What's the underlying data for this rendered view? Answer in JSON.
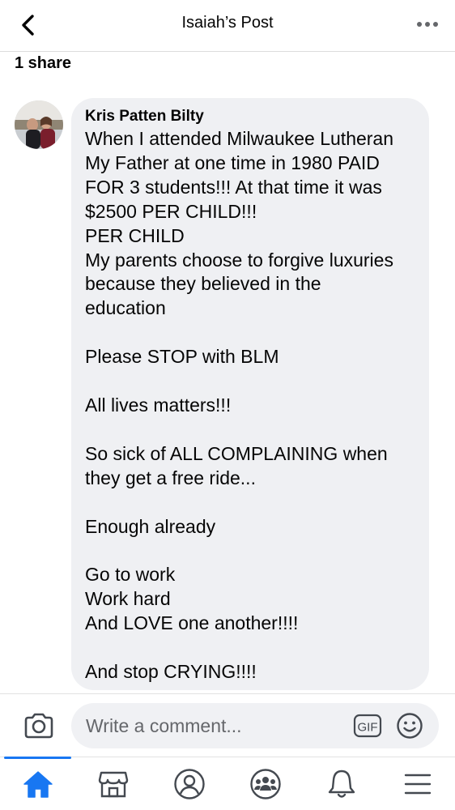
{
  "header": {
    "title": "Isaiah’s Post",
    "back_icon": "chevron-left-icon",
    "more_icon": "more-horizontal-icon"
  },
  "post": {
    "shares_label": "1 share"
  },
  "comment": {
    "author": "Kris Patten Bilty",
    "text": "When I attended Milwaukee Lutheran\nMy Father at one time in 1980 PAID\nFOR 3 students!!! At that time it was\n$2500 PER CHILD!!!\nPER CHILD\nMy parents choose to forgive luxuries\nbecause they believed in the\neducation\n\nPlease STOP with BLM\n\nAll lives matters!!!\n\nSo sick of ALL COMPLAINING when\nthey get a free ride...\n\nEnough already\n\nGo to work\nWork hard\nAnd LOVE one another!!!!\n\nAnd stop CRYING!!!!"
  },
  "composer": {
    "placeholder": "Write a comment...",
    "gif_label": "GIF",
    "camera_icon": "camera-icon",
    "emoji_icon": "emoji-icon"
  },
  "tabbar": {
    "tabs": [
      {
        "icon": "home-icon",
        "active": true
      },
      {
        "icon": "marketplace-icon",
        "active": false
      },
      {
        "icon": "profile-icon",
        "active": false
      },
      {
        "icon": "groups-icon",
        "active": false
      },
      {
        "icon": "notifications-icon",
        "active": false
      },
      {
        "icon": "menu-icon",
        "active": false
      }
    ]
  },
  "colors": {
    "accent": "#1877f2",
    "bubble": "#eff0f3",
    "icon": "#444950"
  }
}
